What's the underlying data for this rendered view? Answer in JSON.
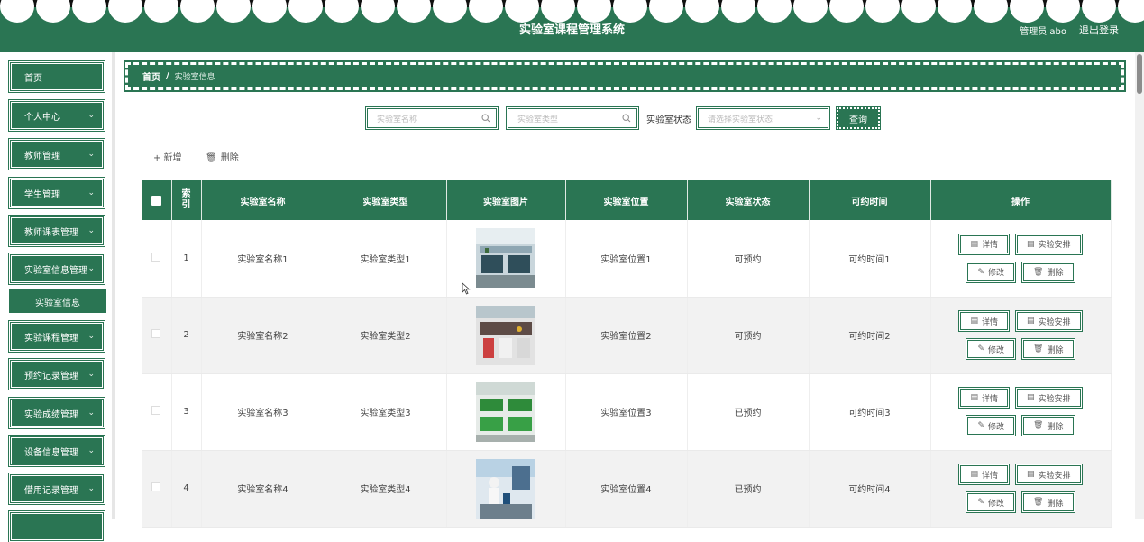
{
  "header": {
    "title": "实验室课程管理系统",
    "admin_label": "管理员 abo",
    "logout_label": "退出登录",
    "bg_color": "#2a7553"
  },
  "sidebar": {
    "items": [
      {
        "label": "首页",
        "has_chevron": false
      },
      {
        "label": "个人中心",
        "has_chevron": true
      },
      {
        "label": "教师管理",
        "has_chevron": true
      },
      {
        "label": "学生管理",
        "has_chevron": true
      },
      {
        "label": "教师课表管理",
        "has_chevron": true
      },
      {
        "label": "实验室信息管理",
        "has_chevron": true
      },
      {
        "label": "实验课程管理",
        "has_chevron": true
      },
      {
        "label": "预约记录管理",
        "has_chevron": true
      },
      {
        "label": "实验成绩管理",
        "has_chevron": true
      },
      {
        "label": "设备信息管理",
        "has_chevron": true
      },
      {
        "label": "借用记录管理",
        "has_chevron": true
      }
    ],
    "active_submenu": "实验室信息"
  },
  "breadcrumb": {
    "home": "首页",
    "separator": "/",
    "current": "实验室信息"
  },
  "search": {
    "name_placeholder": "实验室名称",
    "type_placeholder": "实验室类型",
    "status_label": "实验室状态",
    "status_placeholder": "请选择实验室状态",
    "query_button": "查询"
  },
  "actions": {
    "add": "+ 新增",
    "delete": "删除"
  },
  "table": {
    "headers": [
      "索引",
      "实验室名称",
      "实验室类型",
      "实验室图片",
      "实验室位置",
      "实验室状态",
      "可约时间",
      "操作"
    ],
    "rows": [
      {
        "index": "1",
        "name": "实验室名称1",
        "type": "实验室类型1",
        "location": "实验室位置1",
        "status": "可预约",
        "time": "可约时间1"
      },
      {
        "index": "2",
        "name": "实验室名称2",
        "type": "实验室类型2",
        "location": "实验室位置2",
        "status": "可预约",
        "time": "可约时间2"
      },
      {
        "index": "3",
        "name": "实验室名称3",
        "type": "实验室类型3",
        "location": "实验室位置3",
        "status": "已预约",
        "time": "可约时间3"
      },
      {
        "index": "4",
        "name": "实验室名称4",
        "type": "实验室类型4",
        "location": "实验室位置4",
        "status": "已预约",
        "time": "可约时间4"
      }
    ],
    "op_labels": {
      "detail": "详情",
      "schedule": "实验安排",
      "edit": "修改",
      "remove": "删除"
    }
  }
}
